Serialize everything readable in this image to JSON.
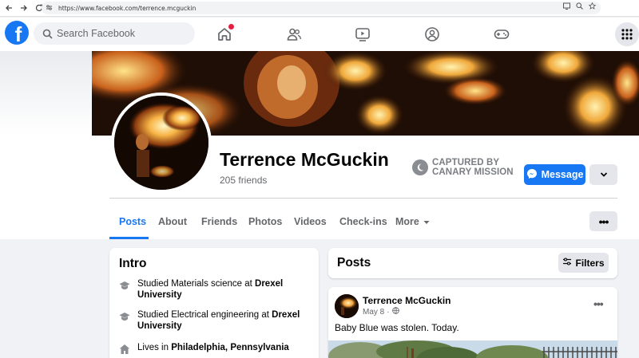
{
  "browser": {
    "url": "https://www.facebook.com/terrence.mcguckin",
    "nav_icons": [
      "back-icon",
      "forward-icon",
      "reload-icon"
    ],
    "right_icons": [
      "screen-icon",
      "zoom-icon",
      "star-icon"
    ]
  },
  "header": {
    "logo_letter": "f",
    "search_placeholder": "Search Facebook",
    "nav": [
      "home-icon",
      "friends-icon",
      "watch-icon",
      "groups-icon",
      "gaming-icon"
    ],
    "home_notification": true,
    "menu_icon": "apps-grid-icon"
  },
  "profile": {
    "name": "Terrence McGuckin",
    "friends": "205 friends",
    "badge_line1": "CAPTURED BY",
    "badge_line2": "CANARY MISSION",
    "message_label": "Message",
    "tabs": [
      "Posts",
      "About",
      "Friends",
      "Photos",
      "Videos",
      "Check-ins",
      "More"
    ],
    "active_tab": "Posts"
  },
  "intro": {
    "title": "Intro",
    "items": [
      {
        "icon": "graduation-cap-icon",
        "prefix": "Studied Materials science at ",
        "bold": "Drexel University"
      },
      {
        "icon": "graduation-cap-icon",
        "prefix": "Studied Electrical engineering at ",
        "bold": "Drexel University"
      },
      {
        "icon": "home-icon",
        "prefix": "Lives in ",
        "bold": "Philadelphia, Pennsylvania"
      }
    ]
  },
  "posts": {
    "title": "Posts",
    "filters_label": "Filters",
    "first_post": {
      "author": "Terrence McGuckin",
      "date": "May 8",
      "separator": "·",
      "privacy_icon": "globe-icon",
      "text": "Baby Blue was stolen. Today."
    }
  },
  "colors": {
    "brand": "#1877f2",
    "background": "#f0f2f5",
    "notification": "#e41e3f"
  }
}
